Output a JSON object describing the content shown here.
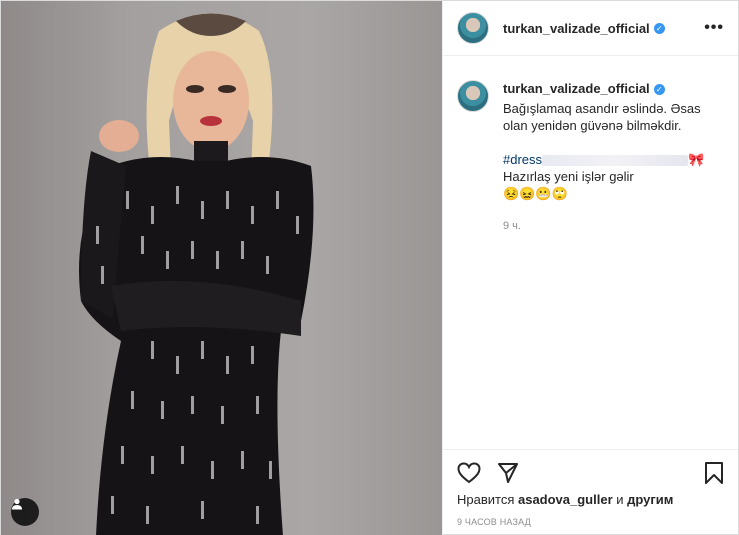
{
  "post": {
    "username": "turkan_valizade_official",
    "verified": true,
    "more_label": "•••",
    "caption": {
      "line1": "Bağışlamaq asandır əslində. Əsas olan yenidən güvənə bilməkdir.",
      "hashtag": "#dress",
      "emoji_bow": "🎀",
      "after_hashtag": " Hazırlaş yeni işlər gəlir",
      "emojis": "😣😖😬🙄"
    },
    "time_ago": "9 ч.",
    "likes": {
      "prefix": "Нравится ",
      "user": "asadova_guller",
      "suffix": " и ",
      "others": "другим"
    },
    "posted_ago": "9 часов назад"
  },
  "icons": {
    "tag": "person-icon",
    "like": "heart-icon",
    "share": "send-icon",
    "save": "bookmark-icon",
    "verified": "verified-badge-icon"
  },
  "colors": {
    "verified": "#3897f0",
    "hashtag": "#00376b",
    "muted": "#8e8e8e"
  }
}
